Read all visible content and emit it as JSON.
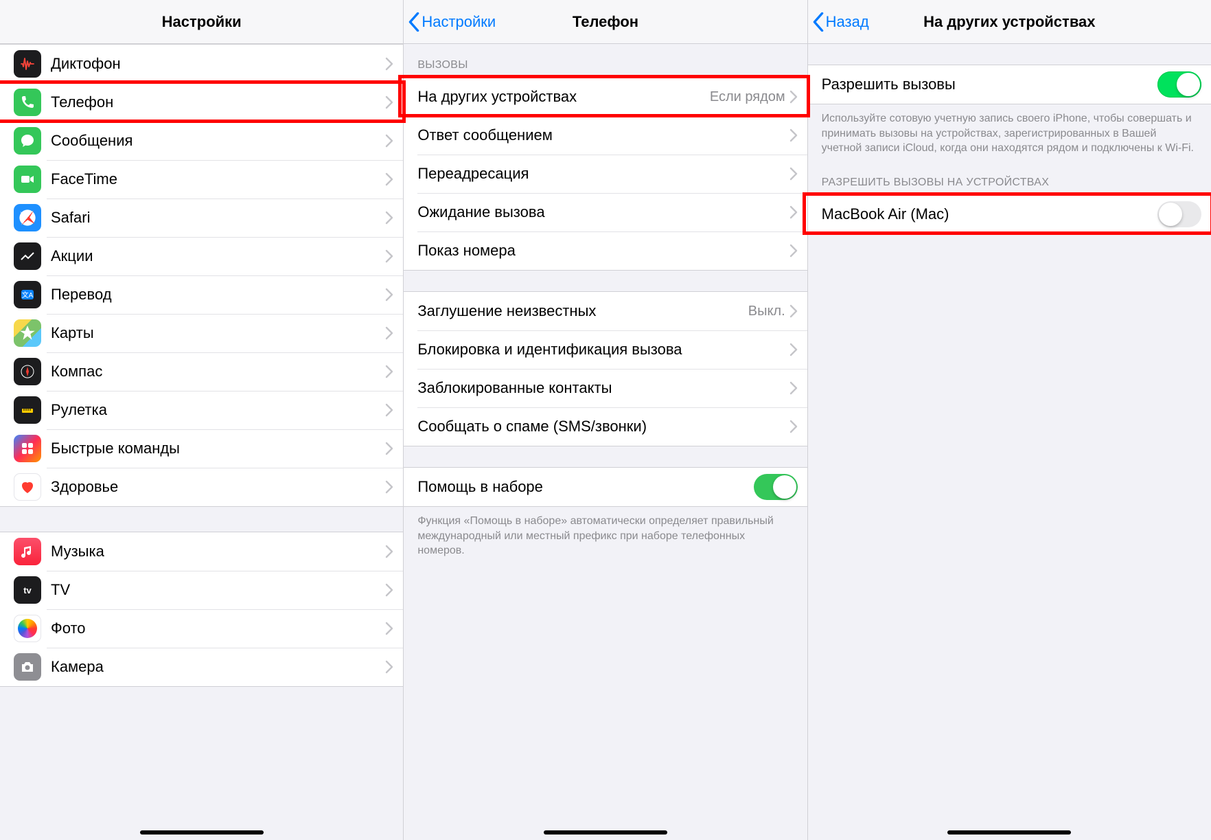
{
  "pane1": {
    "title": "Настройки",
    "groupA": [
      {
        "icon": "voice",
        "label": "Диктофон"
      },
      {
        "icon": "phone",
        "label": "Телефон",
        "hl": true
      },
      {
        "icon": "msg",
        "label": "Сообщения"
      },
      {
        "icon": "ft",
        "label": "FaceTime"
      },
      {
        "icon": "safari",
        "label": "Safari"
      },
      {
        "icon": "stock",
        "label": "Акции"
      },
      {
        "icon": "trans",
        "label": "Перевод"
      },
      {
        "icon": "maps",
        "label": "Карты"
      },
      {
        "icon": "compass",
        "label": "Компас"
      },
      {
        "icon": "measure",
        "label": "Рулетка"
      },
      {
        "icon": "shortcut",
        "label": "Быстрые команды"
      },
      {
        "icon": "health",
        "label": "Здоровье"
      }
    ],
    "groupB": [
      {
        "icon": "music",
        "label": "Музыка"
      },
      {
        "icon": "tv",
        "label": "TV"
      },
      {
        "icon": "photos",
        "label": "Фото"
      },
      {
        "icon": "camera",
        "label": "Камера"
      }
    ]
  },
  "pane2": {
    "back": "Настройки",
    "title": "Телефон",
    "header_calls": "ВЫЗОВЫ",
    "rows_calls": [
      {
        "label": "На других устройствах",
        "detail": "Если рядом",
        "hl": true
      },
      {
        "label": "Ответ сообщением"
      },
      {
        "label": "Переадресация"
      },
      {
        "label": "Ожидание вызова"
      },
      {
        "label": "Показ номера"
      }
    ],
    "rows_block": [
      {
        "label": "Заглушение неизвестных",
        "detail": "Выкл."
      },
      {
        "label": "Блокировка и идентификация вызова"
      },
      {
        "label": "Заблокированные контакты"
      },
      {
        "label": "Сообщать о спаме (SMS/звонки)"
      }
    ],
    "dial_assist": {
      "label": "Помощь в наборе",
      "on": true
    },
    "footer": "Функция «Помощь в наборе» автоматически определяет правильный международный или местный префикс при наборе телефонных номеров."
  },
  "pane3": {
    "back": "Назад",
    "title": "На других устройствах",
    "allow": {
      "label": "Разрешить вызовы",
      "on": true
    },
    "allow_footer": "Используйте сотовую учетную запись своего iPhone, чтобы совершать и принимать вызовы на устройствах, зарегистрированных в Вашей учетной записи iCloud, когда они находятся рядом и подключены к Wi‑Fi.",
    "devices_header": "РАЗРЕШИТЬ ВЫЗОВЫ НА УСТРОЙСТВАХ",
    "devices": [
      {
        "label": "MacBook Air (Mac)",
        "on": false,
        "hl": true
      }
    ]
  }
}
